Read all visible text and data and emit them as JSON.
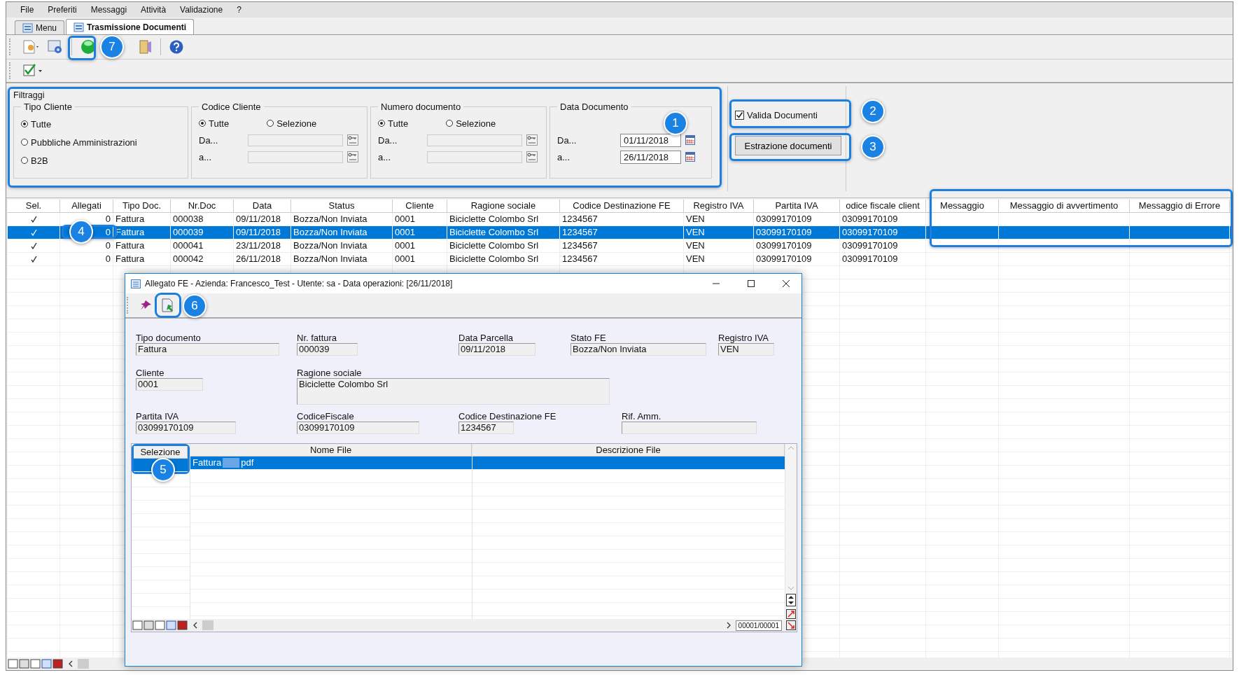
{
  "menu": [
    "File",
    "Preferiti",
    "Messaggi",
    "Attività",
    "Validazione",
    "?"
  ],
  "tabs": [
    {
      "label": "Menu",
      "selected": false
    },
    {
      "label": "Trasmissione Documenti",
      "selected": true
    }
  ],
  "filters": {
    "title": "Filtraggi",
    "groups": [
      {
        "kind": "radio-list",
        "title": "Tipo Cliente",
        "options": [
          {
            "label": "Tutte",
            "selected": true
          },
          {
            "label": "Pubbliche Amministrazioni",
            "selected": false
          },
          {
            "label": "B2B",
            "selected": false
          }
        ]
      },
      {
        "kind": "range",
        "title": "Codice Cliente",
        "options": [
          {
            "label": "Tutte",
            "selected": true
          },
          {
            "label": "Selezione",
            "selected": false
          }
        ],
        "fields": [
          {
            "label": "Da..."
          },
          {
            "label": "a..."
          }
        ]
      },
      {
        "kind": "range",
        "title": "Numero documento",
        "options": [
          {
            "label": "Tutte",
            "selected": true
          },
          {
            "label": "Selezione",
            "selected": false
          }
        ],
        "fields": [
          {
            "label": "Da..."
          },
          {
            "label": "a..."
          }
        ]
      },
      {
        "kind": "dates",
        "title": "Data Documento",
        "fields": [
          {
            "label": "Da...",
            "value": "01/11/2018"
          },
          {
            "label": "a...",
            "value": "26/11/2018"
          }
        ]
      }
    ]
  },
  "validate": {
    "label": "Valida Documenti",
    "checked": true
  },
  "extract_button": "Estrazione documenti",
  "grid": {
    "check_column": "Sel.",
    "columns": [
      "Allegati",
      "Tipo Doc.",
      "Nr.Doc",
      "Data",
      "Status",
      "Cliente",
      "Ragione sociale",
      "Codice Destinazione FE",
      "Registro IVA",
      "Partita IVA",
      "odice fiscale client",
      "Messaggio",
      "Messaggio di avvertimento",
      "Messaggio di Errore"
    ],
    "rows": [
      {
        "checked": true,
        "selected": false,
        "cells": [
          "0",
          "Fattura",
          "000038",
          "09/11/2018",
          "Bozza/Non Inviata",
          "0001",
          "Biciclette Colombo Srl",
          "1234567",
          "VEN",
          "03099170109",
          "03099170109"
        ]
      },
      {
        "checked": true,
        "selected": true,
        "cells": [
          "0",
          "Fattura",
          "000039",
          "09/11/2018",
          "Bozza/Non Inviata",
          "0001",
          "Biciclette Colombo Srl",
          "1234567",
          "VEN",
          "03099170109",
          "03099170109"
        ]
      },
      {
        "checked": true,
        "selected": false,
        "cells": [
          "0",
          "Fattura",
          "000041",
          "23/11/2018",
          "Bozza/Non Inviata",
          "0001",
          "Biciclette Colombo Srl",
          "1234567",
          "VEN",
          "03099170109",
          "03099170109"
        ]
      },
      {
        "checked": true,
        "selected": false,
        "cells": [
          "0",
          "Fattura",
          "000042",
          "26/11/2018",
          "Bozza/Non Inviata",
          "0001",
          "Biciclette Colombo Srl",
          "1234567",
          "VEN",
          "03099170109",
          "03099170109"
        ]
      }
    ]
  },
  "dialog": {
    "title": "Allegato FE - Azienda: Francesco_Test - Utente: sa - Data operazioni: [26/11/2018]",
    "field_rows": [
      [
        {
          "kind": "single",
          "label": "Tipo documento",
          "value": "Fattura"
        },
        {
          "kind": "single",
          "label": "Nr. fattura",
          "value": "000039"
        },
        {
          "kind": "single",
          "label": "Data Parcella",
          "value": "09/11/2018"
        },
        {
          "kind": "single",
          "label": "Stato FE",
          "value": "Bozza/Non Inviata"
        },
        {
          "kind": "single",
          "label": "Registro IVA",
          "value": "VEN"
        }
      ],
      [
        {
          "kind": "single",
          "label": "Cliente",
          "value": "0001"
        },
        {
          "kind": "multiline",
          "label": "Ragione sociale",
          "value": "Biciclette Colombo Srl"
        }
      ],
      [
        {
          "kind": "single",
          "label": "Partita IVA",
          "value": "03099170109"
        },
        {
          "kind": "single",
          "label": "CodiceFiscale",
          "value": "03099170109"
        },
        {
          "kind": "single",
          "label": "Codice Destinazione FE",
          "value": "1234567"
        },
        {
          "kind": "single",
          "label": "Rif. Amm."
        }
      ]
    ],
    "attachments": {
      "columns": [
        "Selezione",
        "Nome File",
        "Descrizione File"
      ],
      "rows": [
        {
          "selected": true,
          "name_parts": [
            "Fattura",
            "pdf"
          ]
        }
      ]
    },
    "record_counter": "00001/00001"
  },
  "callouts": {
    "filters": "1",
    "validate": "2",
    "extract": "3",
    "attachments_cell": "4",
    "selection_column": "5",
    "export_button": "6",
    "status_button": "7"
  }
}
